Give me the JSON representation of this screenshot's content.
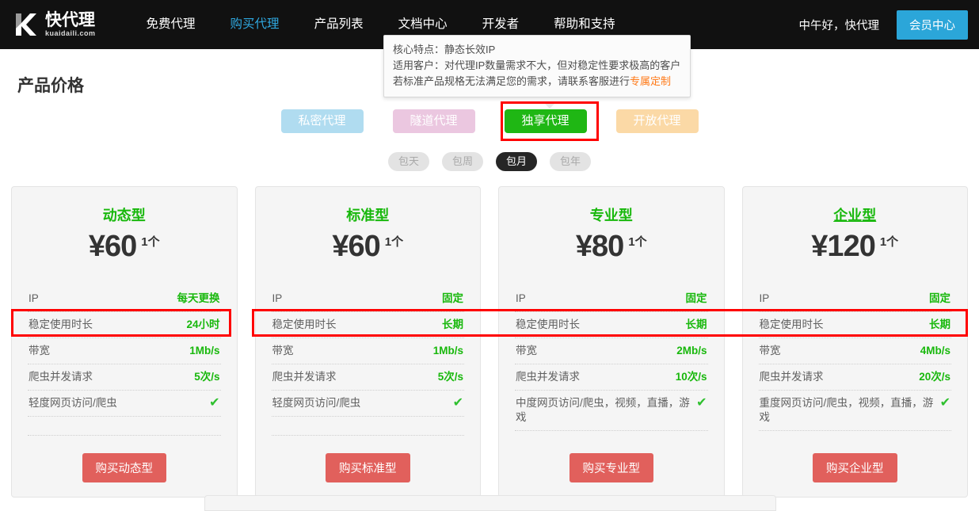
{
  "navbar": {
    "logo_cn": "快代理",
    "logo_en": "kuaidaili.com",
    "links": [
      {
        "label": "免费代理",
        "active": false
      },
      {
        "label": "购买代理",
        "active": true
      },
      {
        "label": "产品列表",
        "active": false
      },
      {
        "label": "文档中心",
        "active": false
      },
      {
        "label": "开发者",
        "active": false
      },
      {
        "label": "帮助和支持",
        "active": false
      }
    ],
    "greeting": "中午好，快代理",
    "member_button": "会员中心",
    "accent_color": "#2ba6d9",
    "background_color": "#111111"
  },
  "tooltip": {
    "line1": "核心特点：静态长效IP",
    "line2": "适用客户：对代理IP数量需求不大，但对稳定性要求极高的客户",
    "line3_prefix": "若标准产品规格无法满足您的需求，请联系客服进行",
    "line3_link": "专属定制",
    "link_color": "#ff7a18"
  },
  "page": {
    "title": "产品价格"
  },
  "category_tabs": [
    {
      "label": "私密代理",
      "color": "#b0dcf0",
      "selected": false
    },
    {
      "label": "隧道代理",
      "color": "#ebc7e0",
      "selected": false
    },
    {
      "label": "独享代理",
      "color": "#1fb714",
      "selected": true
    },
    {
      "label": "开放代理",
      "color": "#fbd9a6",
      "selected": false
    }
  ],
  "duration_tabs": [
    {
      "label": "包天",
      "selected": false
    },
    {
      "label": "包周",
      "selected": false
    },
    {
      "label": "包月",
      "selected": true
    },
    {
      "label": "包年",
      "selected": false
    }
  ],
  "highlight_color": "#ff0000",
  "cards": [
    {
      "title": "动态型",
      "price": "¥60",
      "unit": "1个",
      "specs": [
        {
          "label": "IP",
          "value": "每天更换",
          "type": "text"
        },
        {
          "label": "稳定使用时长",
          "value": "24小时",
          "type": "text",
          "highlighted": true
        },
        {
          "label": "带宽",
          "value": "1Mb/s",
          "type": "text"
        },
        {
          "label": "爬虫并发请求",
          "value": "5次/s",
          "type": "text"
        },
        {
          "label": "轻度网页访问/爬虫",
          "value": "✔",
          "type": "check"
        }
      ],
      "buy_label": "购买动态型"
    },
    {
      "title": "标准型",
      "price": "¥60",
      "unit": "1个",
      "specs": [
        {
          "label": "IP",
          "value": "固定",
          "type": "text"
        },
        {
          "label": "稳定使用时长",
          "value": "长期",
          "type": "text",
          "highlighted": true
        },
        {
          "label": "带宽",
          "value": "1Mb/s",
          "type": "text"
        },
        {
          "label": "爬虫并发请求",
          "value": "5次/s",
          "type": "text"
        },
        {
          "label": "轻度网页访问/爬虫",
          "value": "✔",
          "type": "check"
        }
      ],
      "buy_label": "购买标准型"
    },
    {
      "title": "专业型",
      "price": "¥80",
      "unit": "1个",
      "specs": [
        {
          "label": "IP",
          "value": "固定",
          "type": "text"
        },
        {
          "label": "稳定使用时长",
          "value": "长期",
          "type": "text",
          "highlighted": true
        },
        {
          "label": "带宽",
          "value": "2Mb/s",
          "type": "text"
        },
        {
          "label": "爬虫并发请求",
          "value": "10次/s",
          "type": "text"
        },
        {
          "label": "中度网页访问/爬虫，视频，直播，游戏",
          "value": "✔",
          "type": "check"
        }
      ],
      "buy_label": "购买专业型"
    },
    {
      "title": "企业型",
      "price": "¥120",
      "unit": "1个",
      "specs": [
        {
          "label": "IP",
          "value": "固定",
          "type": "text"
        },
        {
          "label": "稳定使用时长",
          "value": "长期",
          "type": "text",
          "highlighted": true
        },
        {
          "label": "带宽",
          "value": "4Mb/s",
          "type": "text"
        },
        {
          "label": "爬虫并发请求",
          "value": "20次/s",
          "type": "text"
        },
        {
          "label": "重度网页访问/爬虫，视频，直播，游戏",
          "value": "✔",
          "type": "check"
        }
      ],
      "buy_label": "购买企业型"
    }
  ]
}
